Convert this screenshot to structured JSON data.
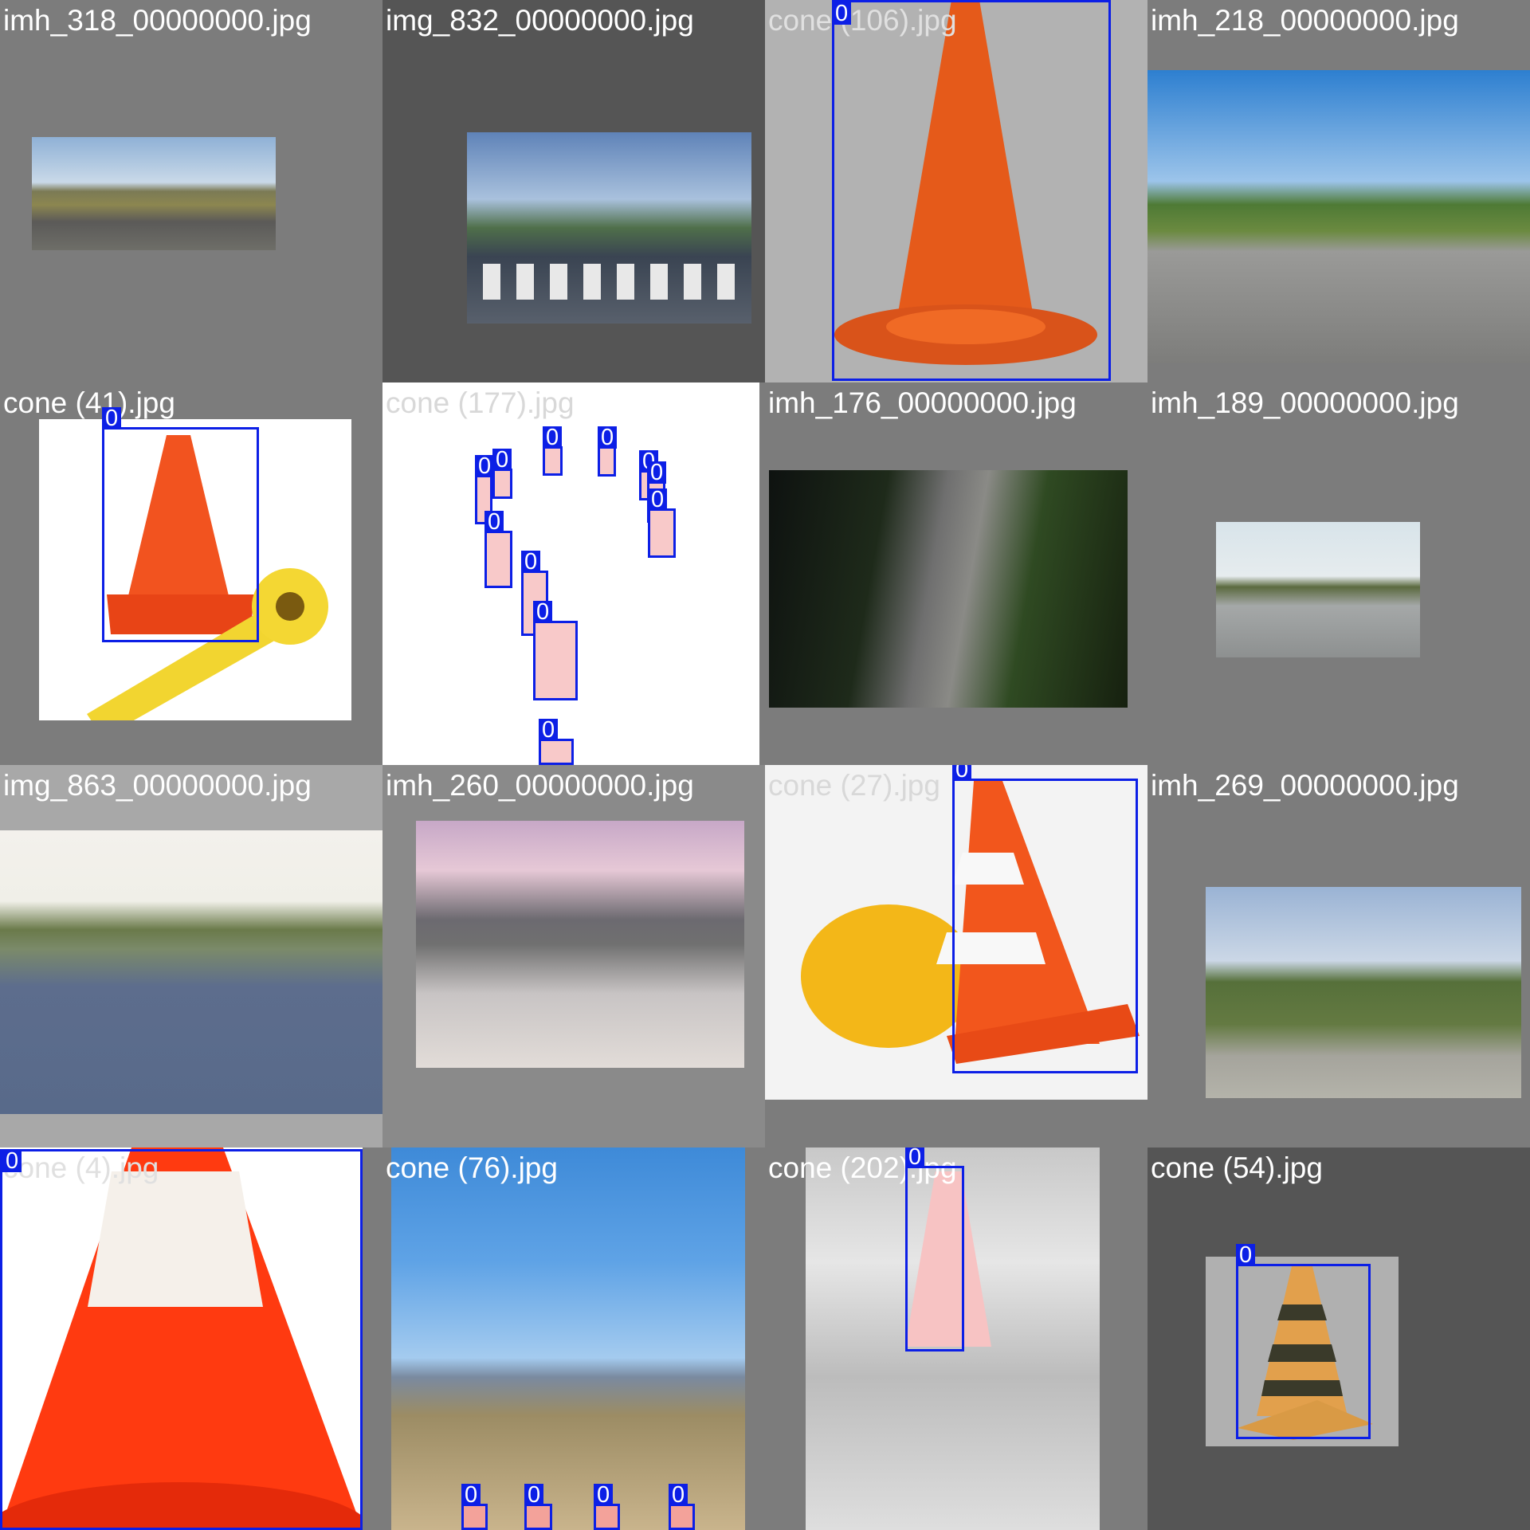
{
  "page": {
    "background": "#808080",
    "box_color": "#0c1fe6"
  },
  "tiles": [
    {
      "filename": "imh_318_00000000.jpg",
      "label_color": "#ffffff"
    },
    {
      "filename": "img_832_00000000.jpg",
      "label_color": "#ffffff"
    },
    {
      "filename": "cone (106).jpg",
      "label_color": "#e0e0e0",
      "boxes": [
        {
          "class": "0"
        }
      ]
    },
    {
      "filename": "imh_218_00000000.jpg",
      "label_color": "#ffffff"
    },
    {
      "filename": "cone (41).jpg",
      "label_color": "#ffffff",
      "boxes": [
        {
          "class": "0"
        }
      ]
    },
    {
      "filename": "cone (177).jpg",
      "label_color": "#d8d8d8",
      "boxes": [
        {
          "class": "0"
        },
        {
          "class": "0"
        },
        {
          "class": "0"
        },
        {
          "class": "0"
        },
        {
          "class": "0"
        },
        {
          "class": "0"
        },
        {
          "class": "0"
        },
        {
          "class": "0"
        },
        {
          "class": "0"
        },
        {
          "class": "0"
        },
        {
          "class": "0"
        }
      ]
    },
    {
      "filename": "imh_176_00000000.jpg",
      "label_color": "#ffffff"
    },
    {
      "filename": "imh_189_00000000.jpg",
      "label_color": "#ffffff"
    },
    {
      "filename": "img_863_00000000.jpg",
      "label_color": "#ffffff"
    },
    {
      "filename": "imh_260_00000000.jpg",
      "label_color": "#ffffff"
    },
    {
      "filename": "cone (27).jpg",
      "label_color": "#d8d8d8",
      "boxes": [
        {
          "class": "0"
        }
      ]
    },
    {
      "filename": "imh_269_00000000.jpg",
      "label_color": "#ffffff"
    },
    {
      "filename": "cone (4).jpg",
      "label_color": "#e0e0e0",
      "boxes": [
        {
          "class": "0"
        }
      ]
    },
    {
      "filename": "cone (76).jpg",
      "label_color": "#ffffff",
      "boxes": [
        {
          "class": "0"
        },
        {
          "class": "0"
        },
        {
          "class": "0"
        },
        {
          "class": "0"
        }
      ]
    },
    {
      "filename": "cone (202).jpg",
      "label_color": "#ffffff",
      "boxes": [
        {
          "class": "0"
        }
      ]
    },
    {
      "filename": "cone (54).jpg",
      "label_color": "#ffffff",
      "boxes": [
        {
          "class": "0"
        }
      ]
    }
  ]
}
